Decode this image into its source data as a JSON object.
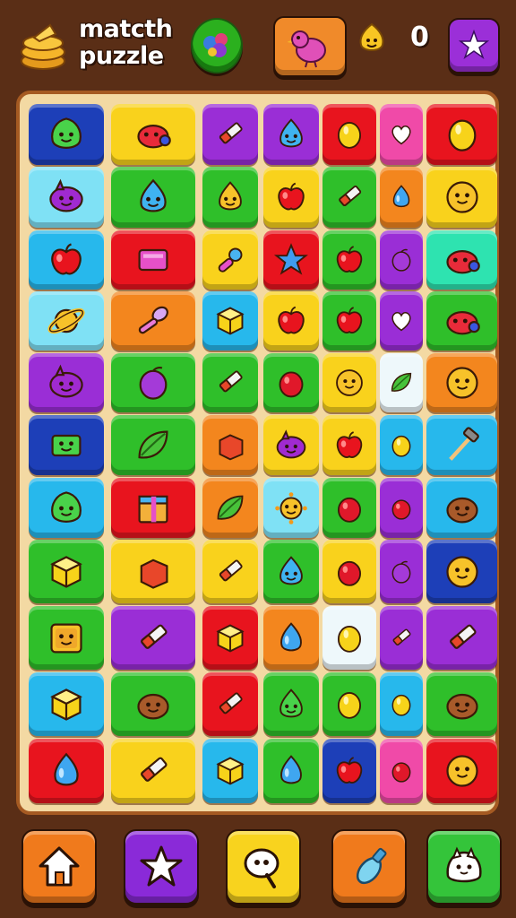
{
  "header": {
    "title_line1": "matcth",
    "title_line2": "puzzle",
    "score": "0"
  },
  "icons": {
    "logo": "stacked-cake-icon",
    "round_button": "berry-bush-icon",
    "bird_button": "bird-icon",
    "score": "smiley-coin-icon",
    "star_button": "star-icon"
  },
  "colors": {
    "background": "#5a2e16",
    "board": "#f3d9a3",
    "board_border": "#a55a22"
  },
  "grid": {
    "columns": 7,
    "rows": 11,
    "tiles": [
      [
        "navy",
        "blob-face"
      ],
      [
        "yellow",
        "red-creature"
      ],
      [
        "purple",
        "crayon"
      ],
      [
        "purple",
        "blue-drop-face"
      ],
      [
        "red",
        "lemon"
      ],
      [
        "pink",
        "heart"
      ],
      [
        "red",
        "lemon"
      ],
      [
        "lightblue",
        "purple-creature"
      ],
      [
        "green",
        "blue-drop-face"
      ],
      [
        "green",
        "yellow-drop-face"
      ],
      [
        "yellow",
        "apple"
      ],
      [
        "green",
        "crayon"
      ],
      [
        "orange",
        "blue-drop"
      ],
      [
        "yellow",
        "smiley"
      ],
      [
        "sky",
        "apple"
      ],
      [
        "red",
        "pink-box"
      ],
      [
        "yellow",
        "pacifier"
      ],
      [
        "red",
        "star"
      ],
      [
        "green",
        "apple"
      ],
      [
        "purple",
        "plum"
      ],
      [
        "mint",
        "red-creature"
      ],
      [
        "lightblue",
        "planet"
      ],
      [
        "orange",
        "spoon"
      ],
      [
        "sky",
        "cube"
      ],
      [
        "yellow",
        "apple"
      ],
      [
        "green",
        "apple"
      ],
      [
        "purple",
        "heart"
      ],
      [
        "green",
        "red-creature"
      ],
      [
        "purple",
        "purple-creature"
      ],
      [
        "green",
        "plum"
      ],
      [
        "green",
        "crayon"
      ],
      [
        "green",
        "red-berry"
      ],
      [
        "yellow",
        "smiley"
      ],
      [
        "white",
        "leaf"
      ],
      [
        "orange",
        "smiley"
      ],
      [
        "navy",
        "green-box"
      ],
      [
        "green",
        "leaf"
      ],
      [
        "orange",
        "red-box"
      ],
      [
        "yellow",
        "purple-creature"
      ],
      [
        "yellow",
        "apple"
      ],
      [
        "sky",
        "lemon"
      ],
      [
        "sky",
        "hammer"
      ],
      [
        "sky",
        "blob-face"
      ],
      [
        "red",
        "gift-box"
      ],
      [
        "orange",
        "leaf"
      ],
      [
        "lightblue",
        "sun"
      ],
      [
        "green",
        "red-berry"
      ],
      [
        "purple",
        "red-berry"
      ],
      [
        "sky",
        "brown-creature"
      ],
      [
        "green",
        "cube"
      ],
      [
        "yellow",
        "red-box"
      ],
      [
        "yellow",
        "crayon"
      ],
      [
        "green",
        "blue-drop-face"
      ],
      [
        "yellow",
        "red-berry"
      ],
      [
        "purple",
        "plum"
      ],
      [
        "navy",
        "smiley"
      ],
      [
        "green",
        "box-face"
      ],
      [
        "purple",
        "crayon"
      ],
      [
        "red",
        "cube"
      ],
      [
        "orange",
        "blue-drop"
      ],
      [
        "white",
        "lemon"
      ],
      [
        "purple",
        "crayon"
      ],
      [
        "purple",
        "crayon"
      ],
      [
        "sky",
        "cube"
      ],
      [
        "green",
        "brown-creature"
      ],
      [
        "red",
        "crayon"
      ],
      [
        "green",
        "green-drop-face"
      ],
      [
        "green",
        "lemon"
      ],
      [
        "sky",
        "lemon"
      ],
      [
        "green",
        "brown-creature"
      ],
      [
        "red",
        "blue-drop"
      ],
      [
        "yellow",
        "crayon"
      ],
      [
        "sky",
        "cube"
      ],
      [
        "green",
        "blue-drop"
      ],
      [
        "navy",
        "apple"
      ],
      [
        "pink",
        "red-berry"
      ],
      [
        "red",
        "smiley"
      ]
    ]
  },
  "footer": {
    "buttons": [
      {
        "name": "home-button",
        "icon": "home-icon"
      },
      {
        "name": "favorites-button",
        "icon": "star-icon"
      },
      {
        "name": "search-button",
        "icon": "magnifier-icon"
      },
      {
        "name": "tool-button",
        "icon": "bottle-icon"
      },
      {
        "name": "mascot-button",
        "icon": "mascot-icon"
      }
    ]
  }
}
